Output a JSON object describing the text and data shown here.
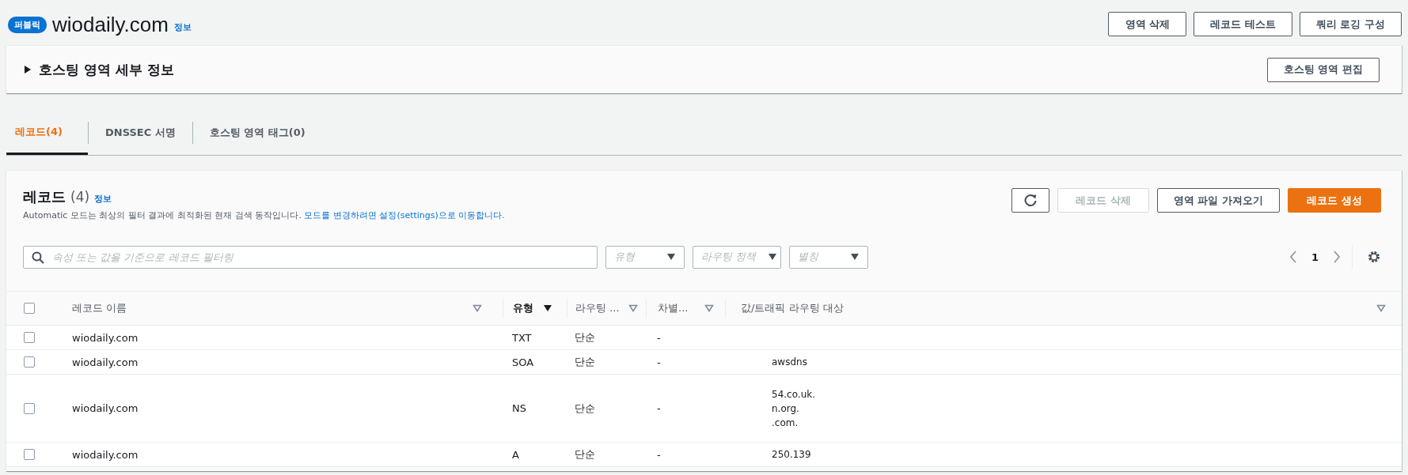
{
  "header": {
    "badge": "퍼블릭",
    "title": "wiodaily.com",
    "info_link": "정보",
    "buttons": [
      "영역 삭제",
      "레코드 테스트",
      "쿼리 로깅 구성"
    ]
  },
  "details": {
    "title": "호스팅 영역 세부 정보",
    "expanded": false,
    "button": "호스팅 영역 편집"
  },
  "tabs": [
    {
      "label": "레코드(4)",
      "selected": true
    },
    {
      "label": "DNSSEC 서명",
      "selected": false
    },
    {
      "label": "호스팅 영역 태그(0)",
      "selected": false
    }
  ],
  "records": {
    "title": "레코드",
    "count": "(4)",
    "info_link": "정보",
    "description": "Automatic 모드는 최상의 필터 결과에 최적화된 현재 검색 동작입니다.",
    "description_link": "모드를 변경하려면 설정(settings)으로 이동합니다.",
    "actions": [
      {
        "label": "레코드 삭제",
        "kind": "disabled"
      },
      {
        "label": "영역 파일 가져오기",
        "kind": "normal"
      },
      {
        "label": "레코드 생성",
        "kind": "primary"
      }
    ],
    "search": {
      "placeholder": "속성 또는 값을 기준으로 레코드 필터링"
    },
    "filters": [
      {
        "placeholder": "유형"
      },
      {
        "placeholder": "라우팅 정책"
      },
      {
        "placeholder": "별칭"
      }
    ],
    "page": "1",
    "select_all": {
      "checked": false
    },
    "columns": [
      {
        "label": "레코드 이름",
        "sorted": false
      },
      {
        "label": "유형",
        "sorted": true
      },
      {
        "label": "라우팅 ...",
        "sorted": false
      },
      {
        "label": "차별...",
        "sorted": false
      },
      {
        "label": "값/트래픽 라우팅 대상",
        "sorted": false
      }
    ],
    "rows": [
      {
        "checked": false,
        "name": "wiodaily.com",
        "type": "TXT",
        "routing": "단순",
        "diff": "-",
        "value_lines": []
      },
      {
        "checked": false,
        "name": "wiodaily.com",
        "type": "SOA",
        "routing": "단순",
        "diff": "-",
        "value_lines": [
          "awsdns"
        ]
      },
      {
        "checked": false,
        "name": "wiodaily.com",
        "type": "NS",
        "routing": "단순",
        "diff": "-",
        "value_lines": [
          "54.co.uk.",
          "n.org.",
          ".com."
        ]
      },
      {
        "checked": false,
        "name": "wiodaily.com",
        "type": "A",
        "routing": "단순",
        "diff": "-",
        "value_lines": [
          "250.139"
        ]
      }
    ]
  }
}
